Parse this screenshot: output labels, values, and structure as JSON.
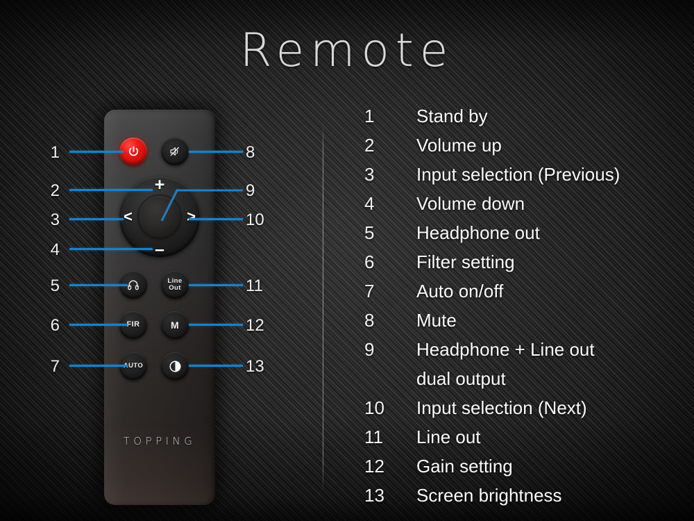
{
  "page": {
    "title": "Remote",
    "brand": "TOPPING"
  },
  "colors": {
    "leader_line": "#1d80c6",
    "power_button": "#e01410",
    "text": "#fbfbfb",
    "background": "#232323"
  },
  "remote": {
    "buttons": [
      {
        "id": "power",
        "icon": "power-icon",
        "label": "",
        "callout": "1"
      },
      {
        "id": "mute",
        "icon": "mute-icon",
        "label": "",
        "callout": "8"
      },
      {
        "id": "volume-up",
        "icon": "plus-icon",
        "label": "+",
        "callout": "2"
      },
      {
        "id": "nav-left",
        "icon": "chevron-left-icon",
        "label": "<",
        "callout": "3"
      },
      {
        "id": "nav-right",
        "icon": "chevron-right-icon",
        "label": ">",
        "callout": "10"
      },
      {
        "id": "volume-down",
        "icon": "minus-icon",
        "label": "–",
        "callout": "4"
      },
      {
        "id": "dual-output",
        "icon": "center-button",
        "label": "",
        "callout": "9"
      },
      {
        "id": "headphone",
        "icon": "headphone-icon",
        "label": "",
        "callout": "5"
      },
      {
        "id": "line-out",
        "icon": "",
        "label_line1": "Line",
        "label_line2": "Out",
        "callout": "11"
      },
      {
        "id": "filter",
        "icon": "",
        "label": "FIR",
        "callout": "6"
      },
      {
        "id": "gain",
        "icon": "",
        "label": "M",
        "callout": "12"
      },
      {
        "id": "auto",
        "icon": "",
        "label": "AUTO",
        "callout": "7"
      },
      {
        "id": "brightness",
        "icon": "contrast-icon",
        "label": "",
        "callout": "13"
      }
    ],
    "callouts_left": [
      "1",
      "2",
      "3",
      "4",
      "5",
      "6",
      "7"
    ],
    "callouts_right": [
      "8",
      "9",
      "10",
      "11",
      "12",
      "13"
    ]
  },
  "legend": {
    "items": [
      {
        "num": "1",
        "text": "Stand by"
      },
      {
        "num": "2",
        "text": "Volume up"
      },
      {
        "num": "3",
        "text": "Input selection (Previous)"
      },
      {
        "num": "4",
        "text": "Volume down"
      },
      {
        "num": "5",
        "text": "Headphone out"
      },
      {
        "num": "6",
        "text": "Filter setting"
      },
      {
        "num": "7",
        "text": "Auto on/off"
      },
      {
        "num": "8",
        "text": "Mute"
      },
      {
        "num": "9",
        "text": "Headphone + Line out",
        "text2": "dual output"
      },
      {
        "num": "10",
        "text": "Input selection (Next)"
      },
      {
        "num": "11",
        "text": "Line out"
      },
      {
        "num": "12",
        "text": "Gain setting"
      },
      {
        "num": "13",
        "text": "Screen brightness"
      }
    ]
  }
}
